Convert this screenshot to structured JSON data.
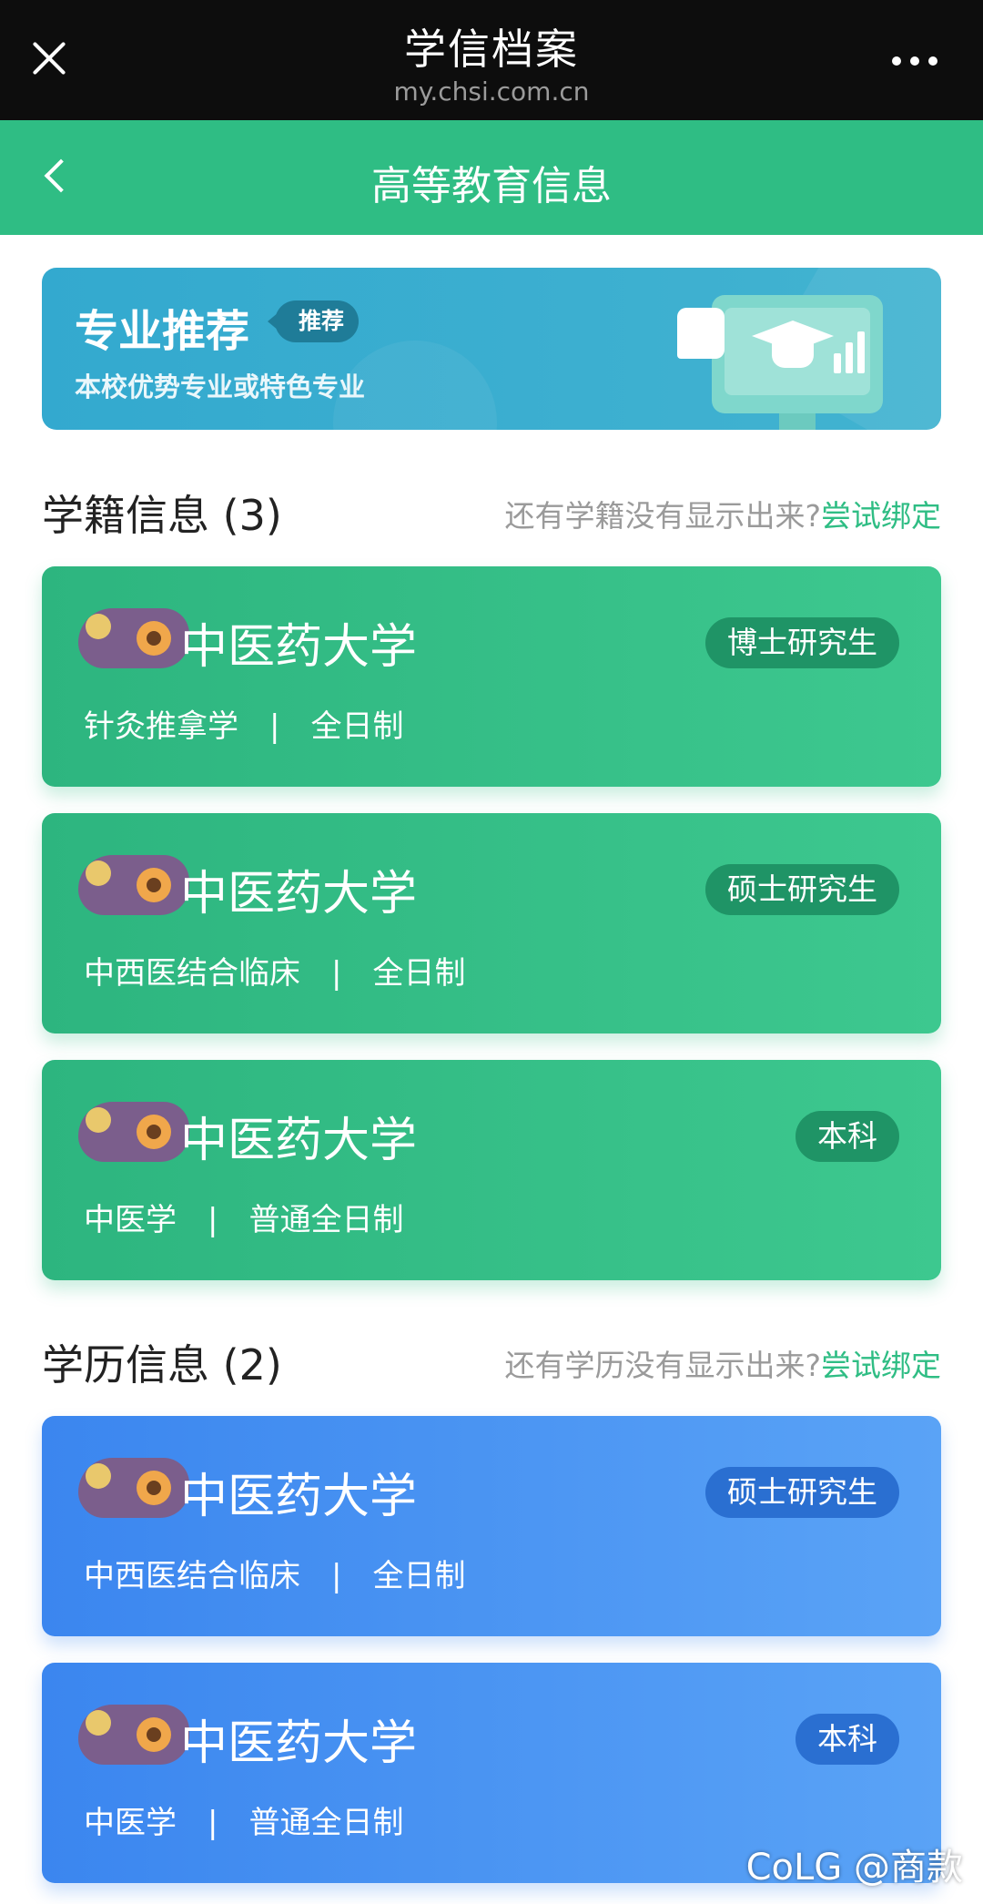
{
  "window": {
    "title": "学信档案",
    "url": "my.chsi.com.cn"
  },
  "nav": {
    "title": "高等教育信息"
  },
  "banner": {
    "title": "专业推荐",
    "tag": "推荐",
    "subtitle": "本校优势专业或特色专业"
  },
  "enrollment": {
    "title": "学籍信息 (3)",
    "hint": "还有学籍没有显示出来?",
    "link": "尝试绑定",
    "cards": [
      {
        "school": "中医药大学",
        "level": "博士研究生",
        "major": "针灸推拿学",
        "separator": "|",
        "mode": "全日制"
      },
      {
        "school": "中医药大学",
        "level": "硕士研究生",
        "major": "中西医结合临床",
        "separator": "|",
        "mode": "全日制"
      },
      {
        "school": "中医药大学",
        "level": "本科",
        "major": "中医学",
        "separator": "|",
        "mode": "普通全日制"
      }
    ]
  },
  "degree": {
    "title": "学历信息 (2)",
    "hint": "还有学历没有显示出来?",
    "link": "尝试绑定",
    "cards": [
      {
        "school": "中医药大学",
        "level": "硕士研究生",
        "major": "中西医结合临床",
        "separator": "|",
        "mode": "全日制"
      },
      {
        "school": "中医药大学",
        "level": "本科",
        "major": "中医学",
        "separator": "|",
        "mode": "普通全日制"
      }
    ]
  },
  "watermark": "CoLG @商款",
  "colors": {
    "brand_green": "#2fbd84",
    "card_blue": "#3b86ef",
    "banner_blue": "#33a9cf"
  }
}
